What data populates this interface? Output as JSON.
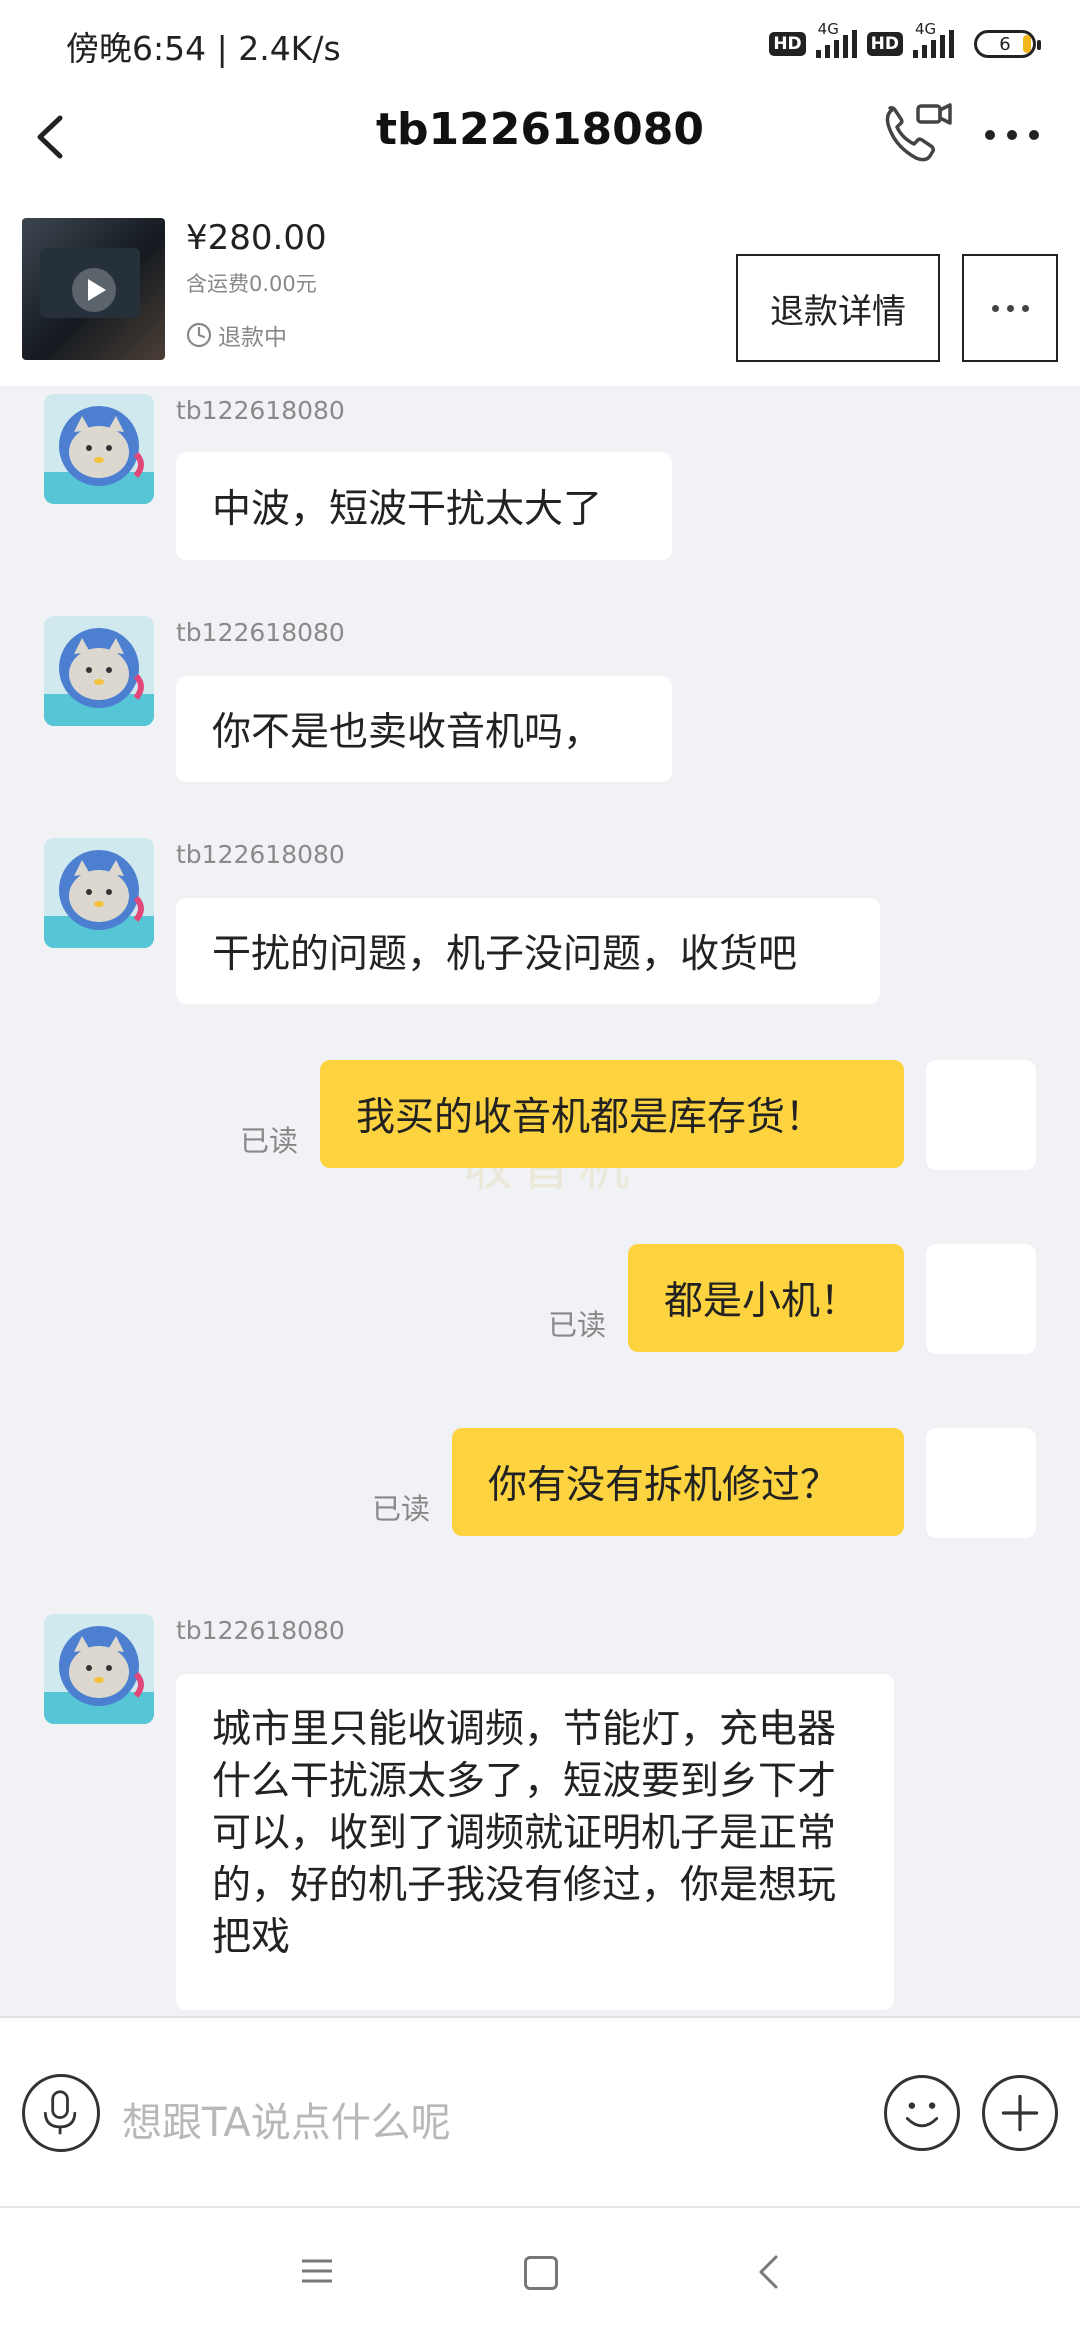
{
  "status_bar": {
    "time": "傍晚6:54 | 2.4K/s",
    "hd1": "HD",
    "net1": "4G",
    "hd2": "HD",
    "net2": "4G",
    "battery": "6"
  },
  "header": {
    "title": "tb122618080"
  },
  "product": {
    "price": "¥280.00",
    "shipping": "含运费0.00元",
    "status": "退款中",
    "refund_button": "退款详情"
  },
  "messages": [
    {
      "side": "left",
      "sender": "tb122618080",
      "text": "中波，短波干扰太大了"
    },
    {
      "side": "left",
      "sender": "tb122618080",
      "text": "你不是也卖收音机吗，"
    },
    {
      "side": "left",
      "sender": "tb122618080",
      "text": "干扰的问题，机子没问题，收货吧"
    },
    {
      "side": "right",
      "read": "已读",
      "text": "我买的收音机都是库存货！"
    },
    {
      "side": "right",
      "read": "已读",
      "text": "都是小机！"
    },
    {
      "side": "right",
      "read": "已读",
      "text": "你有没有拆机修过？"
    },
    {
      "side": "left",
      "sender": "tb122618080",
      "text": "城市里只能收调频，节能灯，充电器什么干扰源太多了，短波要到乡下才可以，收到了调频就证明机子是正常的，好的机子我没有修过，你是想玩把戏"
    }
  ],
  "input": {
    "placeholder": "想跟TA说点什么呢"
  },
  "icons": {
    "back": "chevron-left-icon",
    "call": "phone-video-icon",
    "more": "more-icon",
    "mic": "microphone-icon",
    "emoji": "smile-icon",
    "plus": "plus-icon"
  },
  "colors": {
    "accent_bubble": "#fdd33f",
    "background": "#f1f2f5"
  }
}
